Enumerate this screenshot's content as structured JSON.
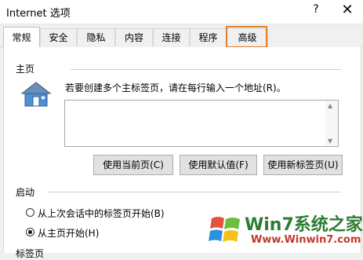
{
  "window": {
    "title": "Internet 选项",
    "help_glyph": "?",
    "close_glyph": "✕"
  },
  "tabs": [
    {
      "label": "常规",
      "active": true
    },
    {
      "label": "安全"
    },
    {
      "label": "隐私"
    },
    {
      "label": "内容"
    },
    {
      "label": "连接"
    },
    {
      "label": "程序"
    },
    {
      "label": "高级",
      "highlighted": true
    }
  ],
  "home": {
    "section": "主页",
    "hint": "若要创建多个主标签页，请在每行输入一个地址(R)。",
    "url_value": "",
    "buttons": {
      "use_current": "使用当前页(C)",
      "use_default": "使用默认值(F)",
      "use_new_tab": "使用新标签页(U)"
    }
  },
  "startup": {
    "section": "启动",
    "options": [
      {
        "label": "从上次会话中的标签页开始(B)",
        "selected": false
      },
      {
        "label": "从主页开始(H)",
        "selected": true
      }
    ]
  },
  "tabs_section": {
    "label": "标签页"
  },
  "watermark": {
    "brand": "Win7系统之家",
    "url": "Www.Winwin7.com"
  },
  "colors": {
    "highlight": "#e0802a",
    "brand_green": "#2d7c32",
    "brand_red": "#c0392b"
  }
}
